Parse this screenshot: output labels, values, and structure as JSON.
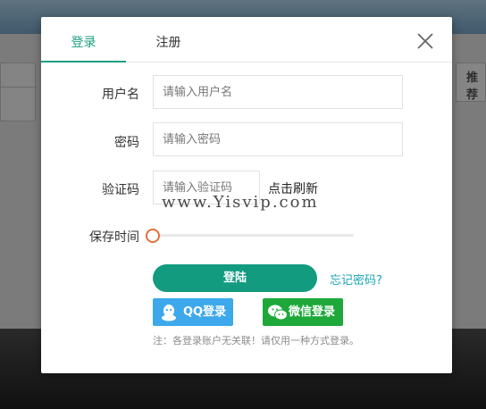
{
  "background": {
    "right_panel_header": "推荐"
  },
  "tabs": [
    {
      "label": "登录",
      "active": true
    },
    {
      "label": "注册",
      "active": false
    }
  ],
  "form": {
    "username": {
      "label": "用户名",
      "value": "",
      "placeholder": "请输入用户名"
    },
    "password": {
      "label": "密码",
      "value": "",
      "placeholder": "请输入密码"
    },
    "captcha": {
      "label": "验证码",
      "value": "",
      "placeholder": "请输入验证码",
      "refresh_label": "点击刷新"
    },
    "save_time": {
      "label": "保存时间",
      "level": 0
    }
  },
  "watermark": "www.Yisvip.com",
  "actions": {
    "submit_label": "登陆",
    "forgot_label": "忘记密码?"
  },
  "sso": {
    "qq_label": "QQ登录",
    "wechat_label": "微信登录"
  },
  "note": "注：各登录账户无关联！请仅用一种方式登录。",
  "colors": {
    "accent": "#1a9f82",
    "submit": "#139b80",
    "link": "#1aa3b6",
    "qq": "#3da8ec",
    "wechat": "#1ea83a",
    "slider_knob": "#e0713b"
  },
  "icons": {
    "close": "close-icon",
    "qq": "qq-icon",
    "wechat": "wechat-icon"
  }
}
